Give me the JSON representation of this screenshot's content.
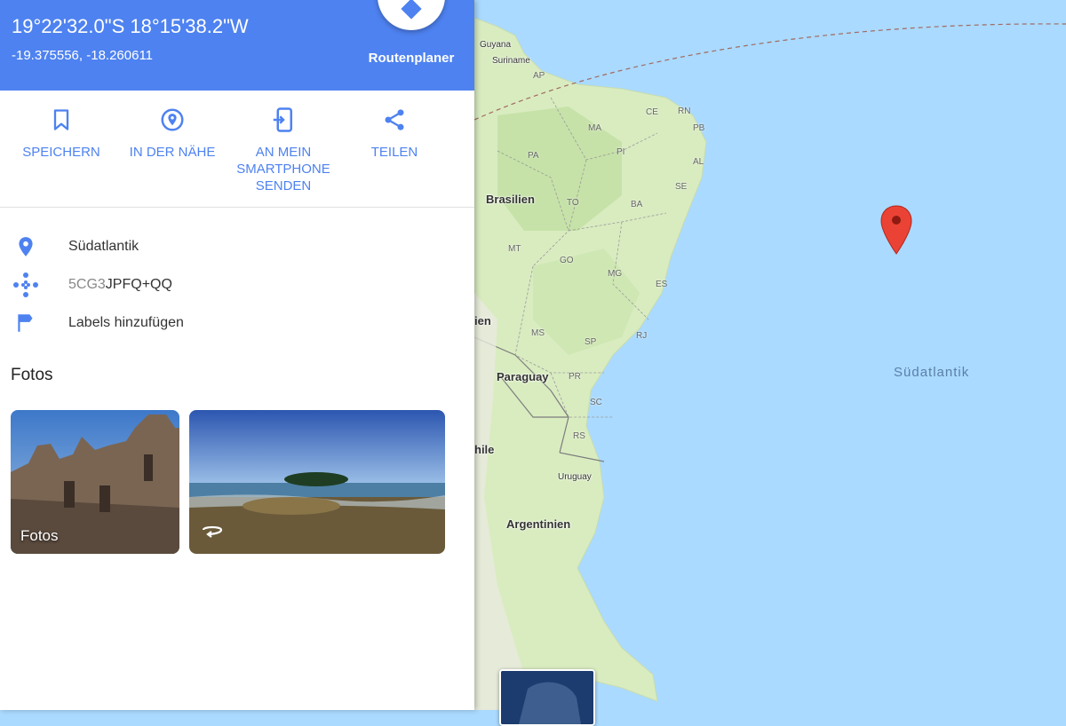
{
  "header": {
    "coords_dms": "19°22'32.0\"S 18°15'38.2\"W",
    "coords_decimal": "-19.375556, -18.260611",
    "route_label": "Routenplaner"
  },
  "actions": [
    {
      "label": "SPEICHERN",
      "icon": "bookmark-icon"
    },
    {
      "label": "IN DER NÄHE",
      "icon": "nearby-icon"
    },
    {
      "label": "AN MEIN SMARTPHONE SENDEN",
      "icon": "send-to-phone-icon"
    },
    {
      "label": "TEILEN",
      "icon": "share-icon"
    }
  ],
  "info": {
    "place": "Südatlantik",
    "plus_code_prefix": "5CG3",
    "plus_code_rest": "JPFQ+QQ",
    "add_label": "Labels hinzufügen"
  },
  "photos": {
    "heading": "Fotos",
    "first_label": "Fotos"
  },
  "map": {
    "countries": [
      "Guyana",
      "Suriname",
      "Brasilien",
      "Paraguay",
      "Uruguay",
      "Argentinien",
      "ien",
      "hile"
    ],
    "states": [
      "AP",
      "CE",
      "RN",
      "PB",
      "MA",
      "PI",
      "AL",
      "PA",
      "SE",
      "TO",
      "BA",
      "MT",
      "GO",
      "MG",
      "ES",
      "MS",
      "SP",
      "RJ",
      "PR",
      "SC",
      "RS"
    ],
    "ocean": "Südatlantik"
  },
  "colors": {
    "accent": "#4e82f0",
    "ocean": "#aadaff",
    "land": "#d9ecc0",
    "pin": "#ea4335"
  }
}
